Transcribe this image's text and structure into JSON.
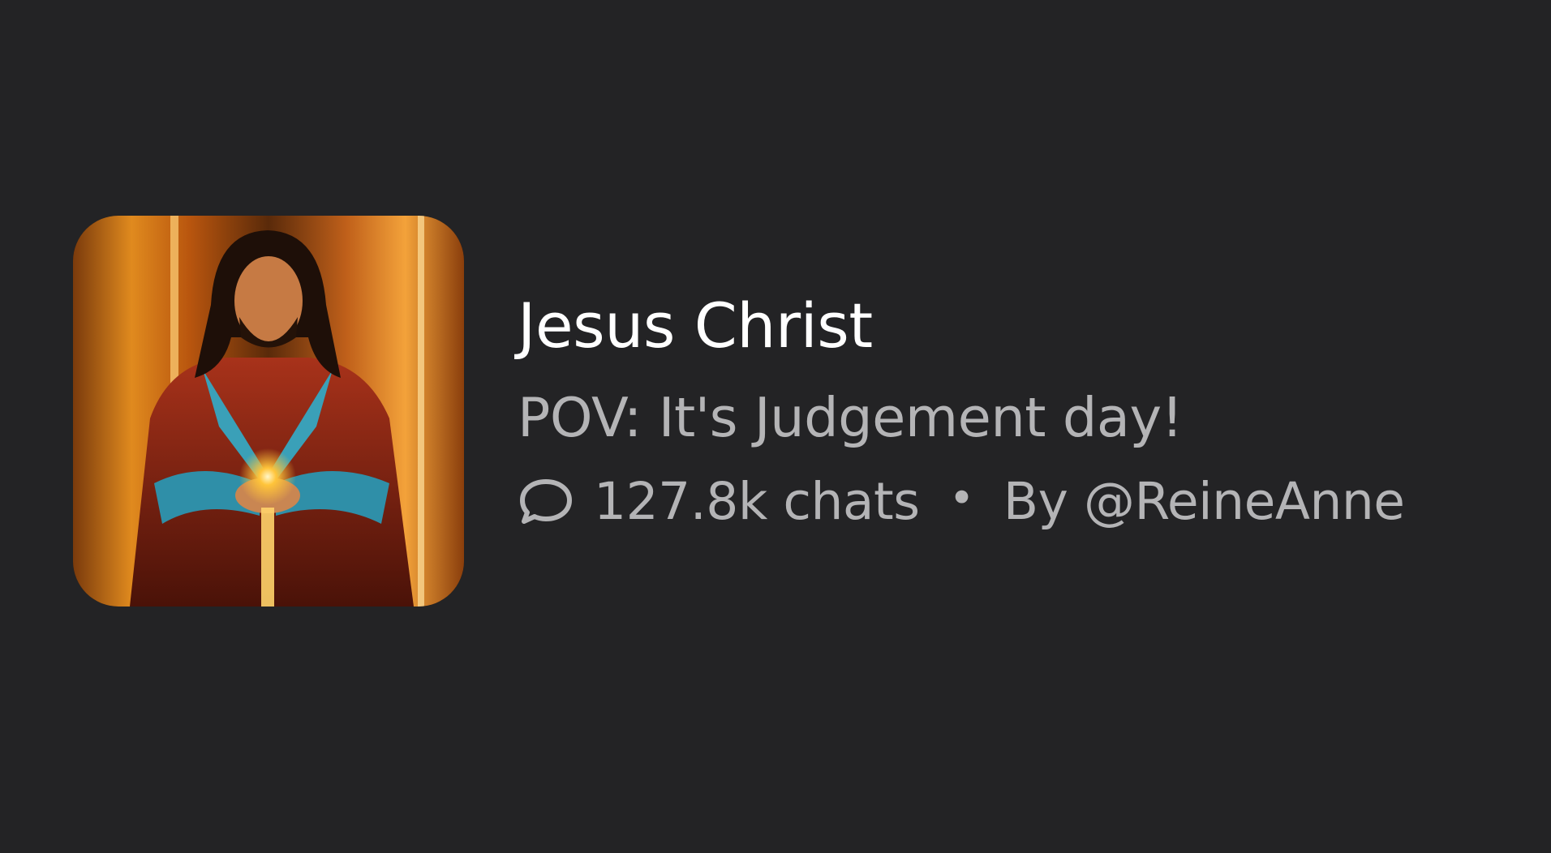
{
  "character": {
    "name": "Jesus Christ",
    "tagline": "POV: It's Judgement day!",
    "chat_count": "127.8k chats",
    "separator": "•",
    "author": "By @ReineAnne"
  },
  "icons": {
    "chats": "speech-bubble-icon"
  },
  "colors": {
    "background": "#232325",
    "title": "#ffffff",
    "secondary_text": "#b4b4b6"
  }
}
